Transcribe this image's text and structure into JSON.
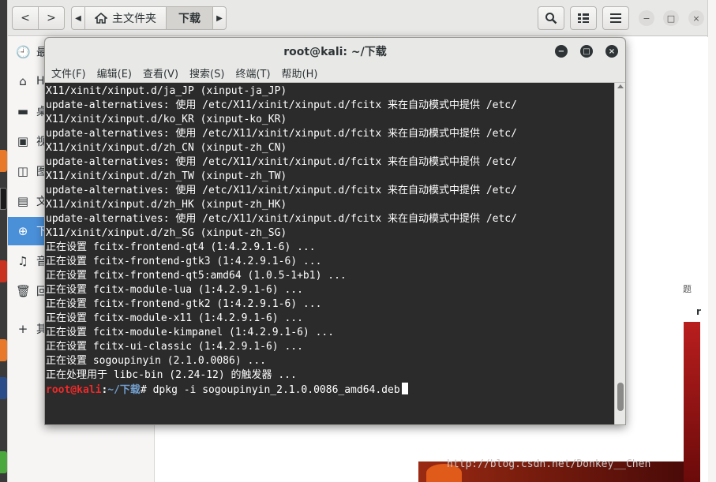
{
  "file_manager": {
    "nav": {
      "back": "<",
      "forward": ">"
    },
    "pathbar": {
      "left_arrow": "◀",
      "home": "主文件夹",
      "current": "下载",
      "right_arrow": "▶"
    },
    "window_controls": {
      "minimize": "−",
      "maximize": "□",
      "close": "×"
    },
    "sidebar": [
      {
        "icon": "clock-icon",
        "glyph": "🕘",
        "label": "最"
      },
      {
        "icon": "home-icon",
        "glyph": "⌂",
        "label": "Ho"
      },
      {
        "icon": "folder-icon",
        "glyph": "▬",
        "label": "桌"
      },
      {
        "icon": "video-icon",
        "glyph": "▣",
        "label": "视"
      },
      {
        "icon": "image-icon",
        "glyph": "◫",
        "label": "图"
      },
      {
        "icon": "document-icon",
        "glyph": "▤",
        "label": "文"
      },
      {
        "icon": "download-icon",
        "glyph": "⊕",
        "label": "下"
      },
      {
        "icon": "music-icon",
        "glyph": "♫",
        "label": "音"
      },
      {
        "icon": "trash-icon",
        "glyph": "🗑",
        "label": "回"
      },
      {
        "icon": "plus-icon",
        "glyph": "+",
        "label": "其"
      }
    ],
    "right_panel": {
      "label1": "题",
      "label2": "r"
    },
    "watermark": "http://blog.csdn.net/Donkey__Chen"
  },
  "terminal": {
    "title": "root@kali: ~/下载",
    "menu": [
      "文件(F)",
      "编辑(E)",
      "查看(V)",
      "搜索(S)",
      "终端(T)",
      "帮助(H)"
    ],
    "window_controls": {
      "minimize": "−",
      "maximize": "□",
      "close": "×"
    },
    "lines": [
      "X11/xinit/xinput.d/ja_JP (xinput-ja_JP)",
      "update-alternatives: 使用 /etc/X11/xinit/xinput.d/fcitx 来在自动模式中提供 /etc/",
      "X11/xinit/xinput.d/ko_KR (xinput-ko_KR)",
      "update-alternatives: 使用 /etc/X11/xinit/xinput.d/fcitx 来在自动模式中提供 /etc/",
      "X11/xinit/xinput.d/zh_CN (xinput-zh_CN)",
      "update-alternatives: 使用 /etc/X11/xinit/xinput.d/fcitx 来在自动模式中提供 /etc/",
      "X11/xinit/xinput.d/zh_TW (xinput-zh_TW)",
      "update-alternatives: 使用 /etc/X11/xinit/xinput.d/fcitx 来在自动模式中提供 /etc/",
      "X11/xinit/xinput.d/zh_HK (xinput-zh_HK)",
      "update-alternatives: 使用 /etc/X11/xinit/xinput.d/fcitx 来在自动模式中提供 /etc/",
      "X11/xinit/xinput.d/zh_SG (xinput-zh_SG)",
      "正在设置 fcitx-frontend-qt4 (1:4.2.9.1-6) ...",
      "正在设置 fcitx-frontend-gtk3 (1:4.2.9.1-6) ...",
      "正在设置 fcitx-frontend-qt5:amd64 (1.0.5-1+b1) ...",
      "正在设置 fcitx-module-lua (1:4.2.9.1-6) ...",
      "正在设置 fcitx-frontend-gtk2 (1:4.2.9.1-6) ...",
      "正在设置 fcitx-module-x11 (1:4.2.9.1-6) ...",
      "正在设置 fcitx-module-kimpanel (1:4.2.9.1-6) ...",
      "正在设置 fcitx-ui-classic (1:4.2.9.1-6) ...",
      "正在设置 sogoupinyin (2.1.0.0086) ...",
      "正在处理用于 libc-bin (2.24-12) 的触发器 ..."
    ],
    "prompt": {
      "user": "root@kali",
      "sep": ":",
      "path": "~/下载",
      "symbol": "# ",
      "command": "dpkg -i sogoupinyin_2.1.0.0086_amd64.deb"
    }
  }
}
